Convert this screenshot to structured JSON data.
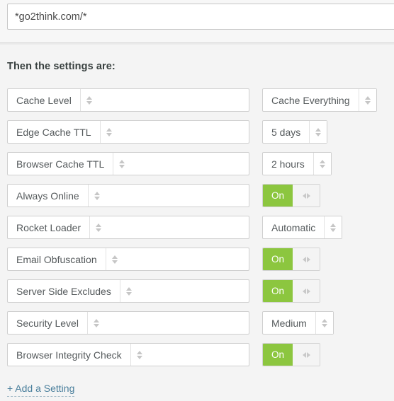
{
  "url_bar": {
    "value": "*go2think.com/*",
    "placeholder": "example.com/*"
  },
  "section": {
    "title": "Then the settings are:"
  },
  "colors": {
    "toggle_on_green": "#8cc63f",
    "link_blue": "#4a7f9c",
    "page_background": "#f4f4f4",
    "box_border": "#cfcfcf"
  },
  "settings": [
    {
      "name": "Cache Level",
      "control": "select",
      "value": "Cache Everything"
    },
    {
      "name": "Edge Cache TTL",
      "control": "select",
      "value": "5 days"
    },
    {
      "name": "Browser Cache TTL",
      "control": "select",
      "value": "2 hours"
    },
    {
      "name": "Always Online",
      "control": "toggle",
      "value": "On"
    },
    {
      "name": "Rocket Loader",
      "control": "select",
      "value": "Automatic"
    },
    {
      "name": "Email Obfuscation",
      "control": "toggle",
      "value": "On"
    },
    {
      "name": "Server Side Excludes",
      "control": "toggle",
      "value": "On"
    },
    {
      "name": "Security Level",
      "control": "select",
      "value": "Medium"
    },
    {
      "name": "Browser Integrity Check",
      "control": "toggle",
      "value": "On"
    }
  ],
  "add_setting": {
    "label": "+ Add a Setting"
  }
}
